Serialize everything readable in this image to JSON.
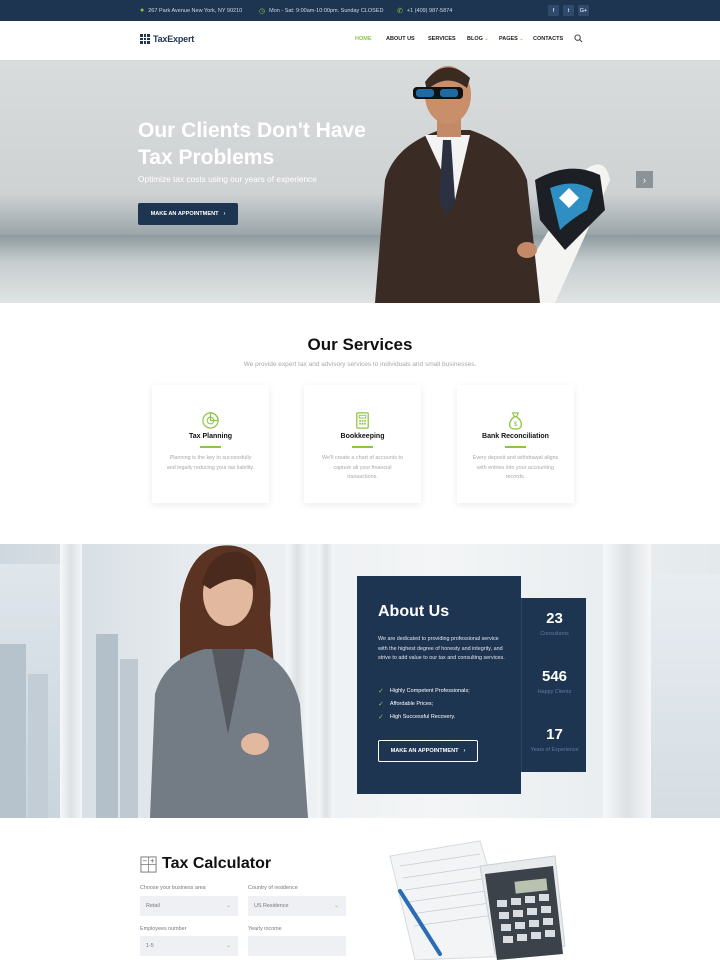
{
  "topbar": {
    "address": "267 Park Avenue New York, NY 90210",
    "hours": "Mon - Sat: 9:00am-10:00pm. Sunday CLOSED",
    "phone": "+1 (409) 987-5874",
    "socials": [
      "f",
      "t",
      "G+"
    ]
  },
  "nav": {
    "logo": "TaxExpert",
    "items": [
      {
        "label": "HOME",
        "active": true
      },
      {
        "label": "ABOUT US"
      },
      {
        "label": "SERVICES"
      },
      {
        "label": "BLOG"
      },
      {
        "label": "PAGES"
      },
      {
        "label": "CONTACTS"
      }
    ]
  },
  "hero": {
    "title": "Our Clients Don't Have Tax Problems",
    "subtitle": "Optimize tax costs using our years of experience",
    "cta": "MAKE AN APPOINTMENT"
  },
  "services": {
    "title": "Our Services",
    "subtitle": "We provide expert tax and advisory services to individuals and small businesses.",
    "cards": [
      {
        "icon": "pie-chart-icon",
        "title": "Tax Planning",
        "text": "Planning is the key to successfully and legally reducing your tax liability."
      },
      {
        "icon": "calculator-icon",
        "title": "Bookkeeping",
        "text": "We'll create a chart of accounts to capture all your financial transactions."
      },
      {
        "icon": "money-bag-icon",
        "title": "Bank Reconciliation",
        "text": "Every deposit and withdrawal aligns with entries into your accounting records."
      }
    ]
  },
  "about": {
    "title": "About Us",
    "text": "We are dedicated to providing professional service with the highest degree of honesty and integrity, and strive to add value to our tax and consulting services.",
    "features": [
      "Highly Competent Professionals;",
      "Affordable Prices;",
      "High Successful Recovery."
    ],
    "cta": "MAKE AN APPOINTMENT",
    "stats": [
      {
        "value": "23",
        "label": "Consultants"
      },
      {
        "value": "546",
        "label": "Happy Clients"
      },
      {
        "value": "17",
        "label": "Years of Experience"
      }
    ]
  },
  "calculator": {
    "title": "Tax Calculator",
    "fields": [
      {
        "label": "Choose your business area",
        "value": "Retail"
      },
      {
        "label": "Country of residence",
        "value": "US Residence"
      },
      {
        "label": "Employees number",
        "value": "1-5"
      },
      {
        "label": "Yearly income",
        "value": ""
      }
    ]
  },
  "colors": {
    "navy": "#1e3552",
    "accent": "#8cc63f"
  }
}
